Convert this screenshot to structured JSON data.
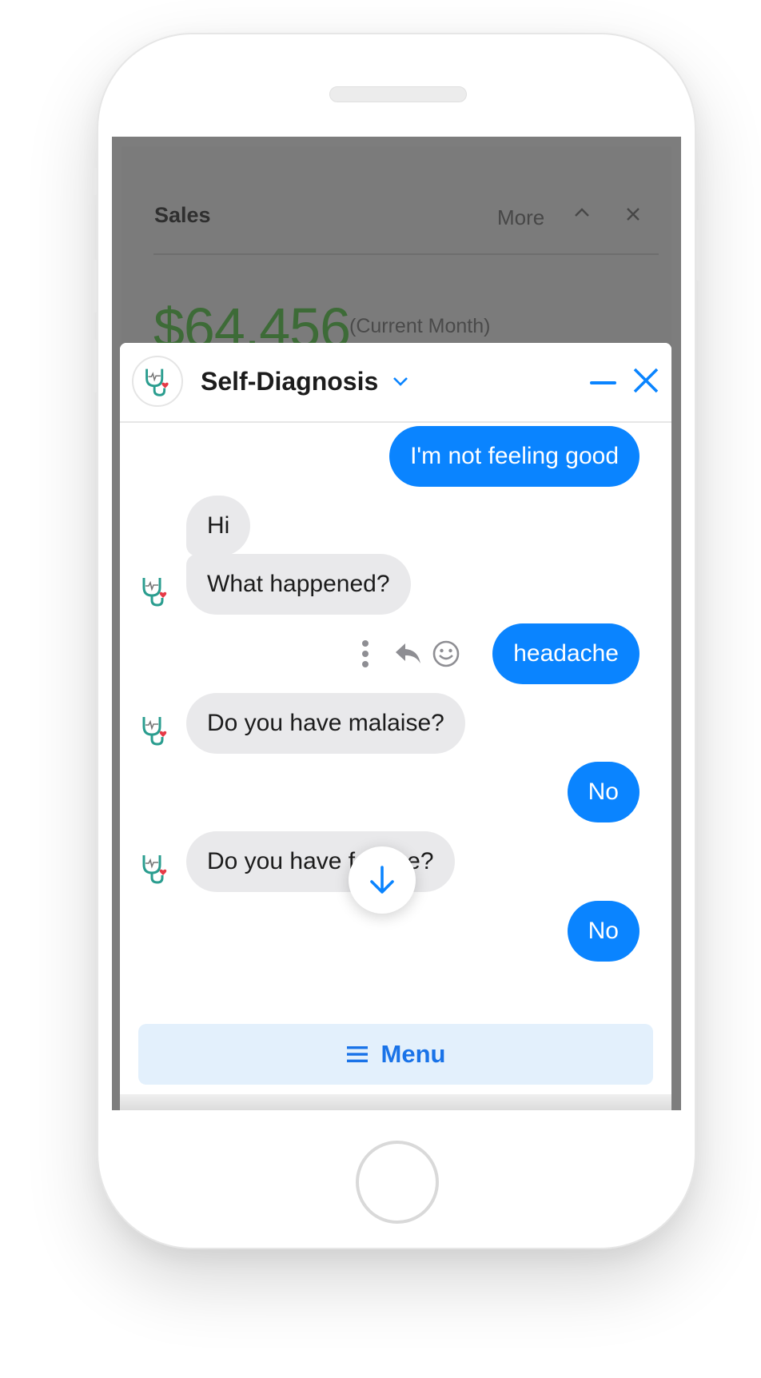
{
  "background_app": {
    "card_title": "Sales",
    "more_label": "More",
    "collapse_glyph": "^",
    "close_glyph": "×",
    "amount": "$64,456",
    "period": "(Current Month)"
  },
  "chat": {
    "title": "Self-Diagnosis",
    "avatar_icon": "stethoscope-heart-icon",
    "accent_color": "#0a84ff",
    "messages": [
      {
        "from": "user",
        "text": "I'm not feeling good"
      },
      {
        "from": "bot",
        "text": "Hi"
      },
      {
        "from": "bot",
        "text": "What happened?"
      },
      {
        "from": "user",
        "text": "headache"
      },
      {
        "from": "bot",
        "text": "Do you have malaise?"
      },
      {
        "from": "user",
        "text": "No"
      },
      {
        "from": "bot",
        "text": "Do you have fatigue?"
      },
      {
        "from": "user",
        "text": "No"
      }
    ],
    "menu_label": "Menu",
    "menu_icon": "hamburger-icon"
  }
}
